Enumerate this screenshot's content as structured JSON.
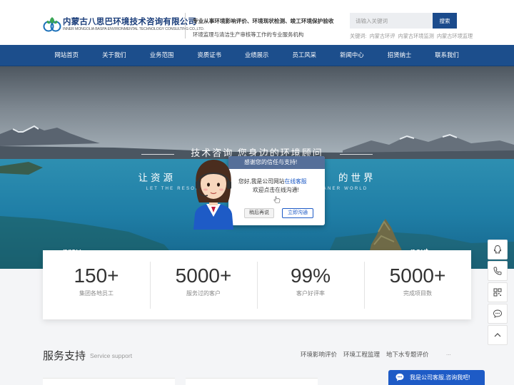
{
  "header": {
    "logo_cn": "内蒙古八思巴环境技术咨询有限公司",
    "logo_en": "INNER MONGOLIA BASPA ENVIRONMENTAL TECHNOLOGY CONSULTING CO.,LTD.",
    "tagline1": "专业从事环境影响评价、环境现状检测、竣工环境保护验收",
    "tagline2": "环境监理与清洁生产审核等工作的专业服务机构",
    "search_placeholder": "请输入关键词",
    "search_button": "搜索",
    "hotwords_label": "关键词:",
    "hotwords": [
      "内蒙古环评",
      "内蒙古环境监测",
      "内蒙古环境监理"
    ]
  },
  "nav": {
    "items": [
      "网站首页",
      "关于我们",
      "业务范围",
      "资质证书",
      "业绩展示",
      "员工风采",
      "新闻中心",
      "招贤纳士",
      "联系我们"
    ]
  },
  "banner": {
    "slogan1": "技术咨询  您身边的环境顾问",
    "slogan2_left": "让资源",
    "slogan2_right": "的世界",
    "slogan_en_left": "LET THE RESOU",
    "slogan_en_right": "EANER WORLD",
    "prev": "prev",
    "next": "next"
  },
  "popup": {
    "title": "感谢您的信任与支持!",
    "msg_prefix": "您好,我是公司网站",
    "msg_highlight": "在线客服",
    "msg2": "欢迎点击在线沟通!",
    "later_button": "稍后再说",
    "chat_button": "立即沟通"
  },
  "stats": [
    {
      "number": "150+",
      "label": "集团各地员工"
    },
    {
      "number": "5000+",
      "label": "服务过的客户"
    },
    {
      "number": "99%",
      "label": "客户好评率"
    },
    {
      "number": "5000+",
      "label": "完成项目数"
    }
  ],
  "side_tools": [
    "qq-icon",
    "phone-icon",
    "qrcode-icon",
    "chat-icon",
    "back-to-top-icon"
  ],
  "service": {
    "title": "服务支持",
    "title_en": "Service support",
    "tabs": [
      "环境影响评价",
      "环境工程监理",
      "地下水专题评价"
    ],
    "more": "..."
  },
  "chat_bar": {
    "text": "我是公司客服,咨询我吧!"
  },
  "colors": {
    "brand_blue": "#1c4e8c",
    "accent_blue": "#1e5bc6",
    "popup_header": "#556f99"
  }
}
